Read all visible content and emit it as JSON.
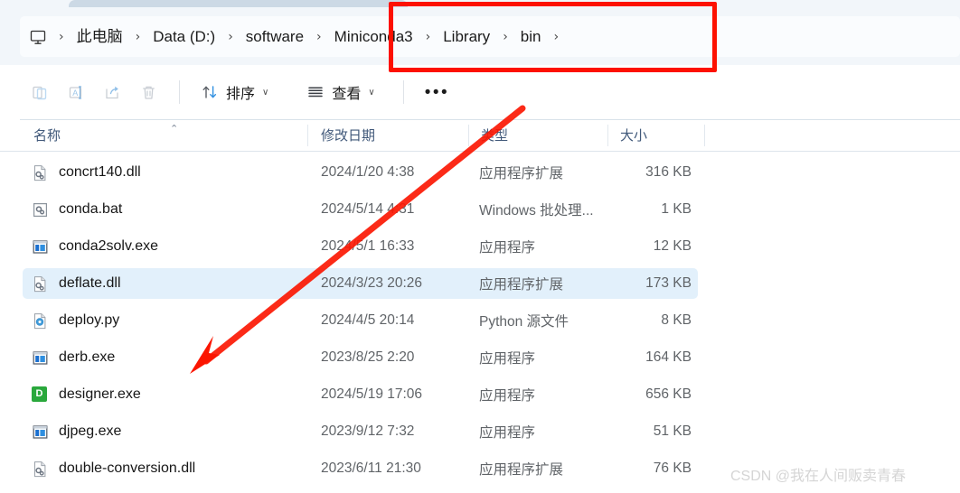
{
  "window": {
    "tab_active": true
  },
  "breadcrumb": {
    "home_icon": "this-pc-monitor-icon",
    "separator": "›",
    "items": [
      {
        "label": "此电脑"
      },
      {
        "label": "Data (D:)"
      },
      {
        "label": "software"
      },
      {
        "label": "Miniconda3"
      },
      {
        "label": "Library"
      },
      {
        "label": "bin"
      }
    ]
  },
  "toolbar": {
    "buttons": [
      {
        "name": "paste-button",
        "icon": "paste-icon",
        "label": "",
        "disabled": true
      },
      {
        "name": "rename-button",
        "icon": "rename-icon",
        "label": "",
        "disabled": true
      },
      {
        "name": "share-button",
        "icon": "share-icon",
        "label": "",
        "disabled": true
      },
      {
        "name": "delete-button",
        "icon": "trash-icon",
        "label": "",
        "disabled": true
      }
    ],
    "sort_label": "排序",
    "view_label": "查看",
    "chevron": "∨",
    "more_label": "•••"
  },
  "columns": {
    "name": "名称",
    "date_modified": "修改日期",
    "type": "类型",
    "size": "大小",
    "sort_caret": "⌃"
  },
  "files": [
    {
      "name": "concrt140.dll",
      "icon": "dll-file-icon",
      "date": "2024/1/20 4:38",
      "type": "应用程序扩展",
      "size": "316 KB",
      "selected": false
    },
    {
      "name": "conda.bat",
      "icon": "bat-file-icon",
      "date": "2024/5/14 4:31",
      "type": "Windows 批处理...",
      "size": "1 KB",
      "selected": false
    },
    {
      "name": "conda2solv.exe",
      "icon": "exe-file-icon",
      "date": "2024/5/1 16:33",
      "type": "应用程序",
      "size": "12 KB",
      "selected": false
    },
    {
      "name": "deflate.dll",
      "icon": "dll-file-icon",
      "date": "2024/3/23 20:26",
      "type": "应用程序扩展",
      "size": "173 KB",
      "selected": true
    },
    {
      "name": "deploy.py",
      "icon": "python-file-icon",
      "date": "2024/4/5 20:14",
      "type": "Python 源文件",
      "size": "8 KB",
      "selected": false
    },
    {
      "name": "derb.exe",
      "icon": "exe-file-icon",
      "date": "2023/8/25 2:20",
      "type": "应用程序",
      "size": "164 KB",
      "selected": false
    },
    {
      "name": "designer.exe",
      "icon": "designer-green-d-icon",
      "date": "2024/5/19 17:06",
      "type": "应用程序",
      "size": "656 KB",
      "selected": false
    },
    {
      "name": "djpeg.exe",
      "icon": "exe-file-icon",
      "date": "2023/9/12 7:32",
      "type": "应用程序",
      "size": "51 KB",
      "selected": false
    },
    {
      "name": "double-conversion.dll",
      "icon": "dll-file-icon",
      "date": "2023/6/11 21:30",
      "type": "应用程序扩展",
      "size": "76 KB",
      "selected": false
    }
  ],
  "annotations": {
    "highlight_color": "#fd1100",
    "arrow_color": "#fb1500",
    "designer_d_letter": "D"
  },
  "watermark": {
    "text": "CSDN @我在人间贩卖青春"
  }
}
